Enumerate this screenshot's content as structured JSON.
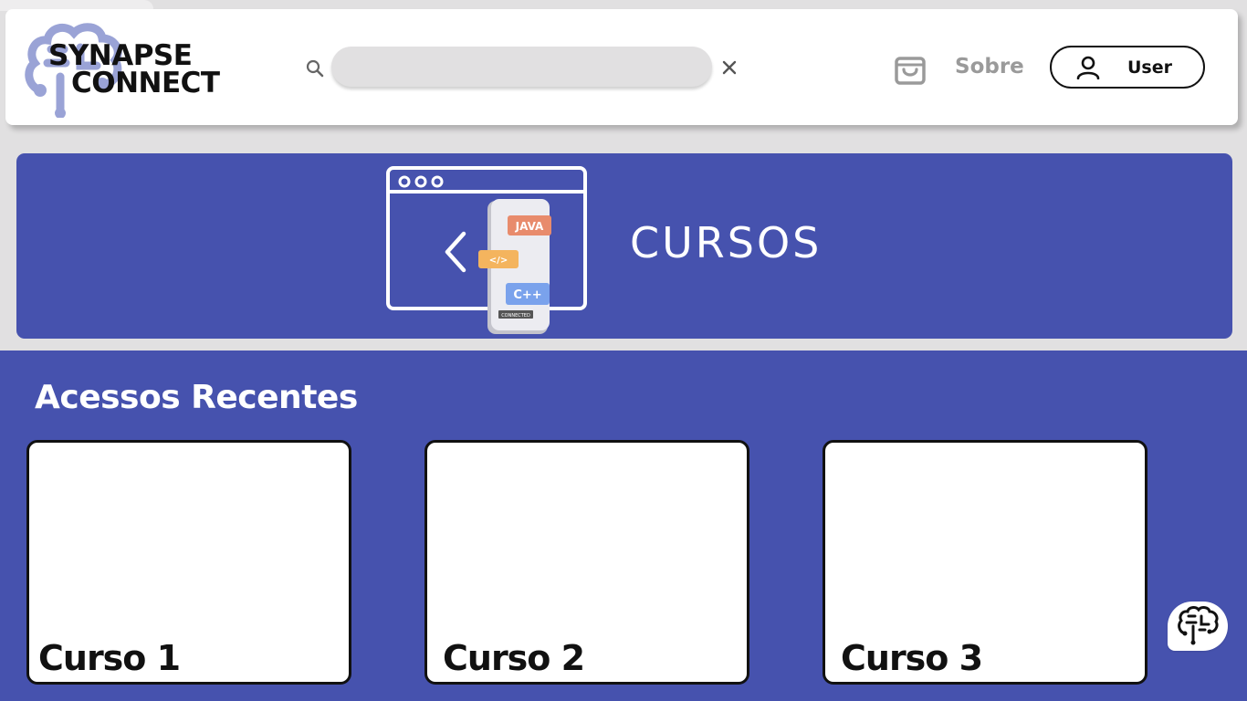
{
  "brand": {
    "line1": "SYNAPSE",
    "line2": "CONNECT"
  },
  "search": {
    "placeholder": ""
  },
  "nav": {
    "sobre_label": "Sobre",
    "user_label": "User"
  },
  "banner": {
    "title": "CURSOS",
    "illustration_tags": [
      "JAVA",
      "</>",
      "C++",
      "CONNECTED"
    ]
  },
  "recent": {
    "title": "Acessos Recentes",
    "courses": [
      {
        "label": "Curso 1"
      },
      {
        "label": "Curso 2"
      },
      {
        "label": "Curso 3"
      }
    ]
  },
  "colors": {
    "primary": "#4652ae",
    "background": "#e1e0e1",
    "logo_brain": "#9aa3d6",
    "muted_text": "#9a9a9a"
  },
  "icons": [
    "brain-logo-icon",
    "search-icon",
    "close-icon",
    "shopping-bag-icon",
    "user-icon",
    "brain-chat-icon"
  ]
}
